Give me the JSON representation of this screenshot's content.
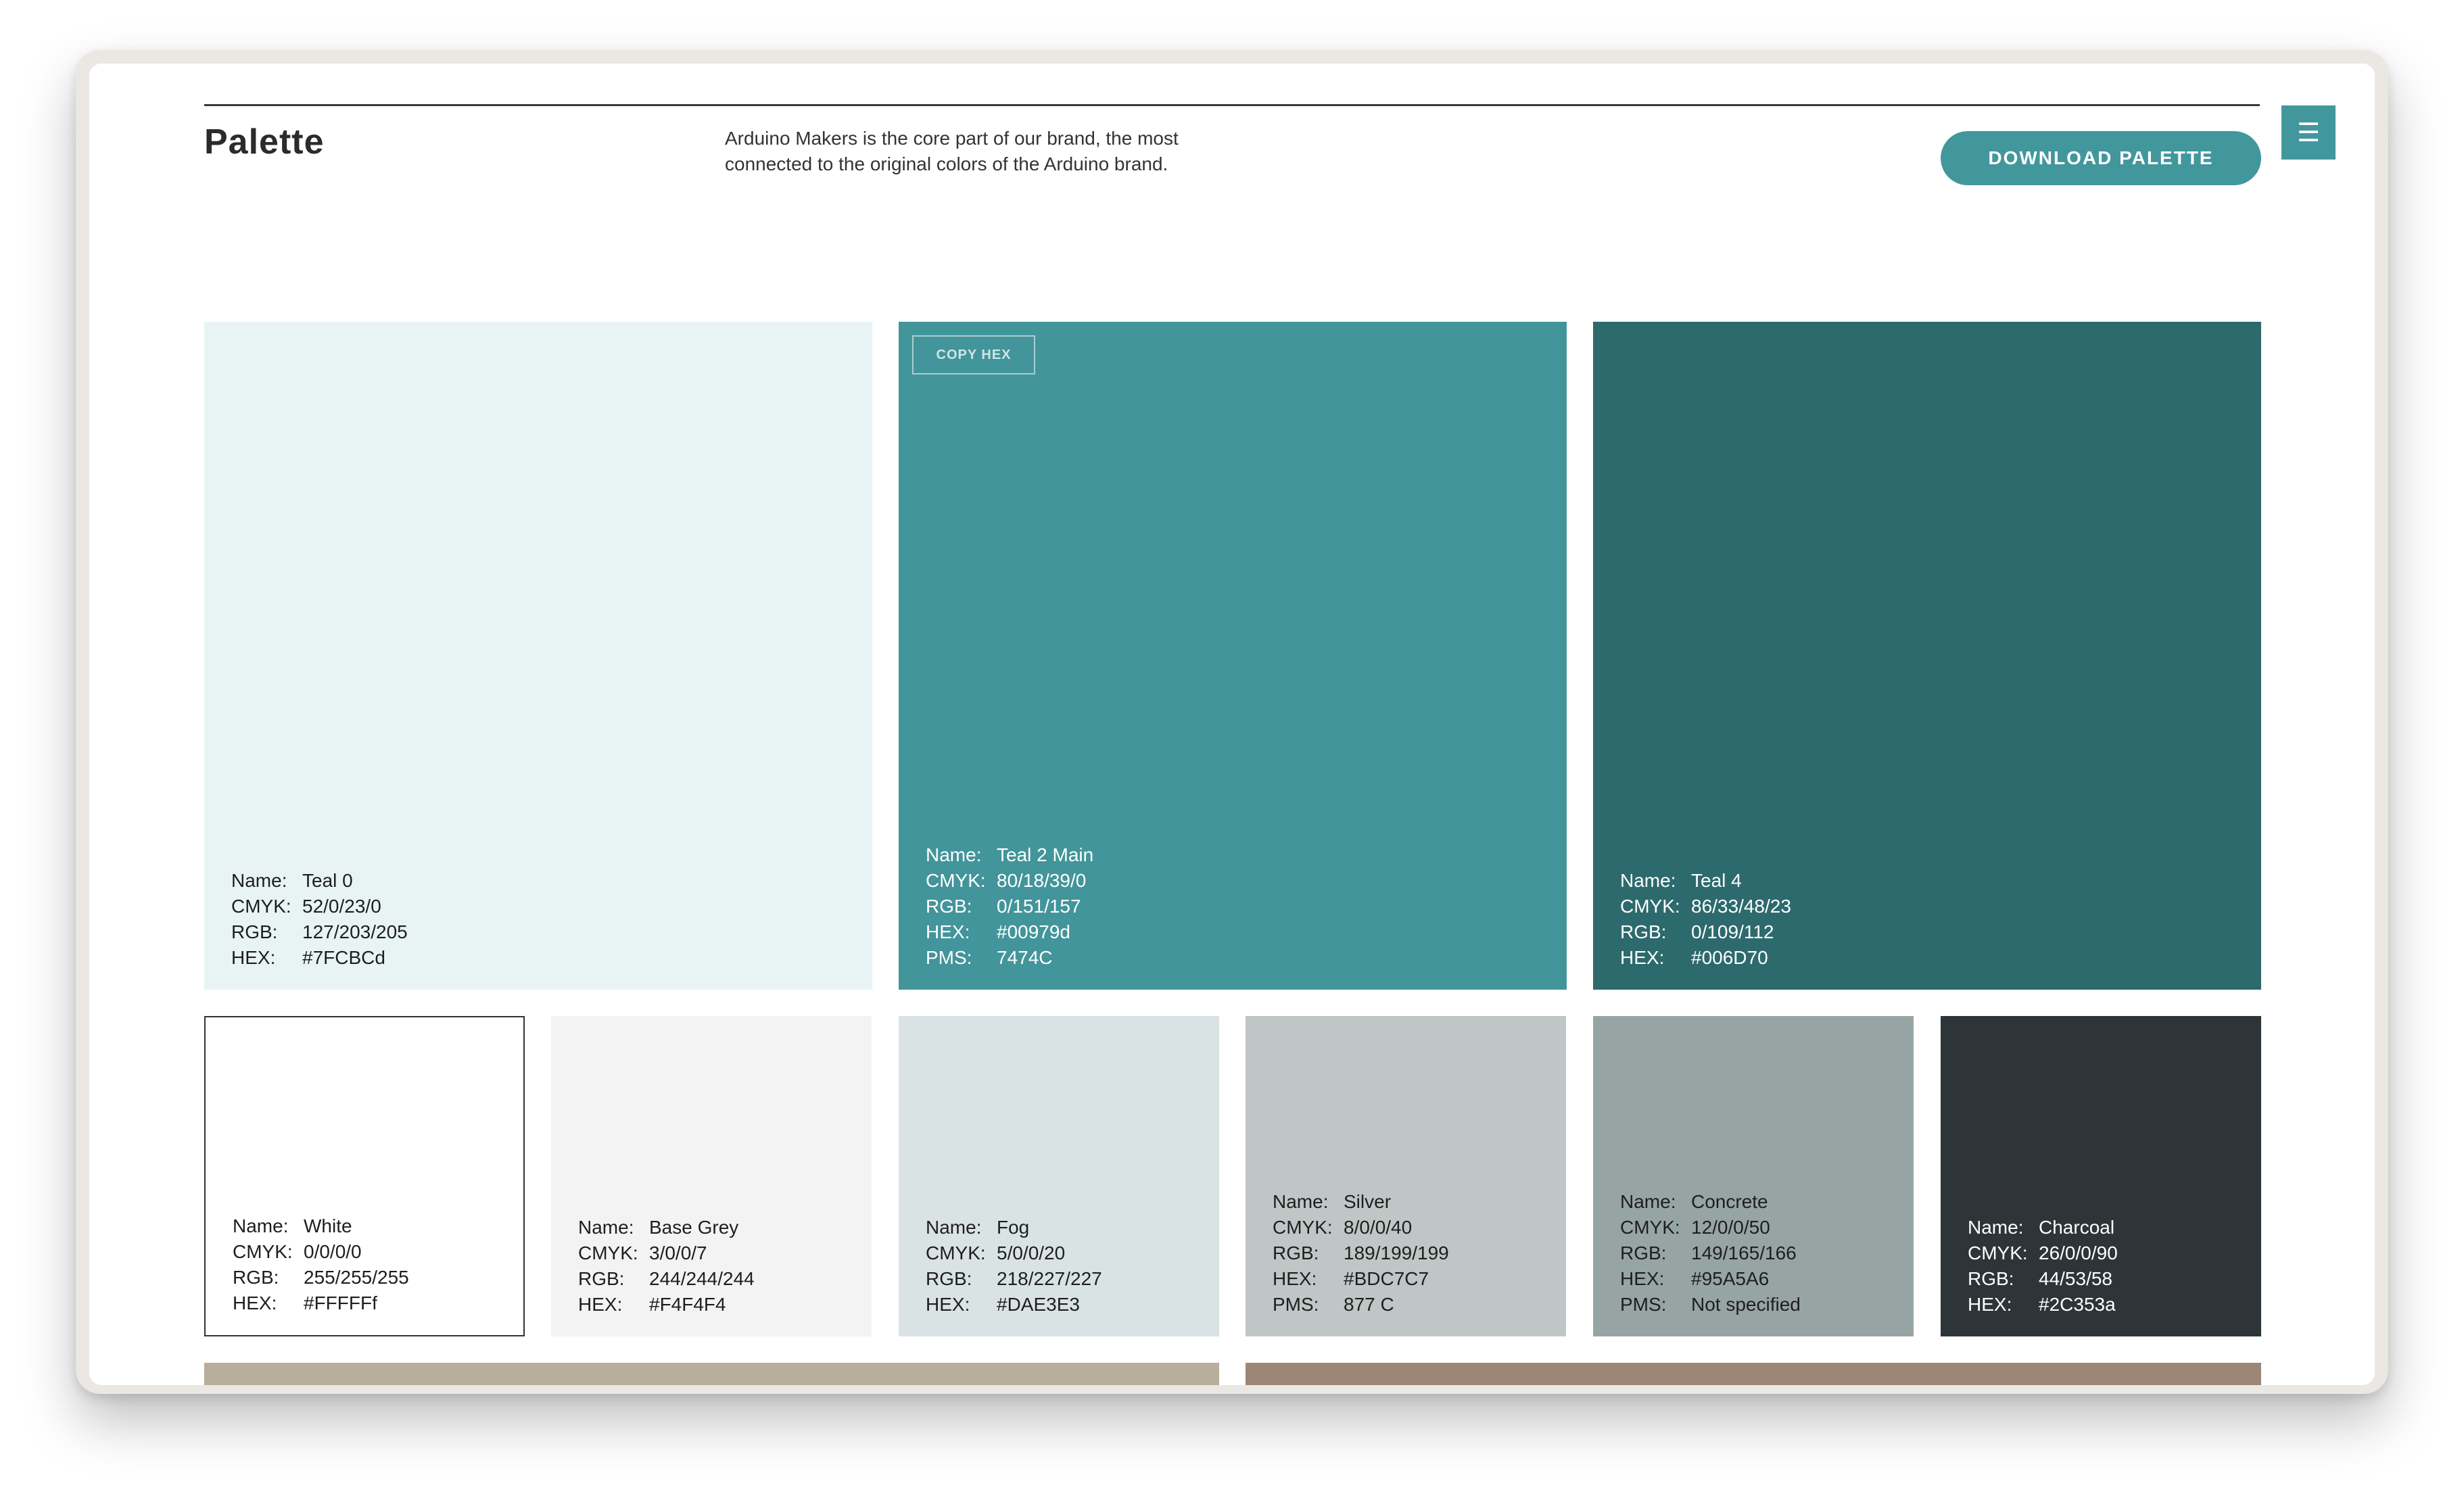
{
  "header": {
    "title": "Palette",
    "description": "Arduino Makers is the core part of our brand, the most connected to the original colors of the Arduino brand.",
    "download_label": "DOWNLOAD PALETTE",
    "menu_icon": "☰"
  },
  "labels": {
    "name": "Name:",
    "cmyk": "CMYK:",
    "rgb": "RGB:",
    "hex": "HEX:",
    "pms": "PMS:"
  },
  "primary": [
    {
      "name": "Teal 0",
      "cmyk": "52/0/23/0",
      "rgb": "127/203/205",
      "hex": "#7FCBCd",
      "color": "#e8f4f4"
    },
    {
      "name": "Teal 2 Main",
      "cmyk": "80/18/39/0",
      "rgb": "0/151/157",
      "hex": "#00979d",
      "pms": "7474C",
      "color": "#42959a",
      "copy_label": "COPY HEX"
    },
    {
      "name": "Teal 4",
      "cmyk": "86/33/48/23",
      "rgb": "0/109/112",
      "hex": "#006D70",
      "color": "#2d6a6d"
    }
  ],
  "secondary": [
    {
      "name": "White",
      "cmyk": "0/0/0/0",
      "rgb": "255/255/255",
      "hex": "#FFFFFf",
      "color": "#ffffff"
    },
    {
      "name": "Base Grey",
      "cmyk": "3/0/0/7",
      "rgb": "244/244/244",
      "hex": "#F4F4F4",
      "color": "#f3f3f3"
    },
    {
      "name": "Fog",
      "cmyk": "5/0/0/20",
      "rgb": "218/227/227",
      "hex": "#DAE3E3",
      "color": "#dae3e3"
    },
    {
      "name": "Silver",
      "cmyk": "8/0/0/40",
      "rgb": "189/199/199",
      "hex": "#BDC7C7",
      "pms": "877 C",
      "color": "#bec7c6"
    },
    {
      "name": "Concrete",
      "cmyk": "12/0/0/50",
      "rgb": "149/165/166",
      "hex": "#95A5A6",
      "pms": "Not specified",
      "color": "#97a4a4"
    },
    {
      "name": "Charcoal",
      "cmyk": "26/0/0/90",
      "rgb": "44/53/58",
      "hex": "#2C353a",
      "color": "#2d3538"
    }
  ],
  "tertiary_colors": [
    "#b9ad9c",
    "#9c8675"
  ],
  "colors": {
    "accent": "#42979d",
    "title_rule": "#3a3a3a"
  }
}
